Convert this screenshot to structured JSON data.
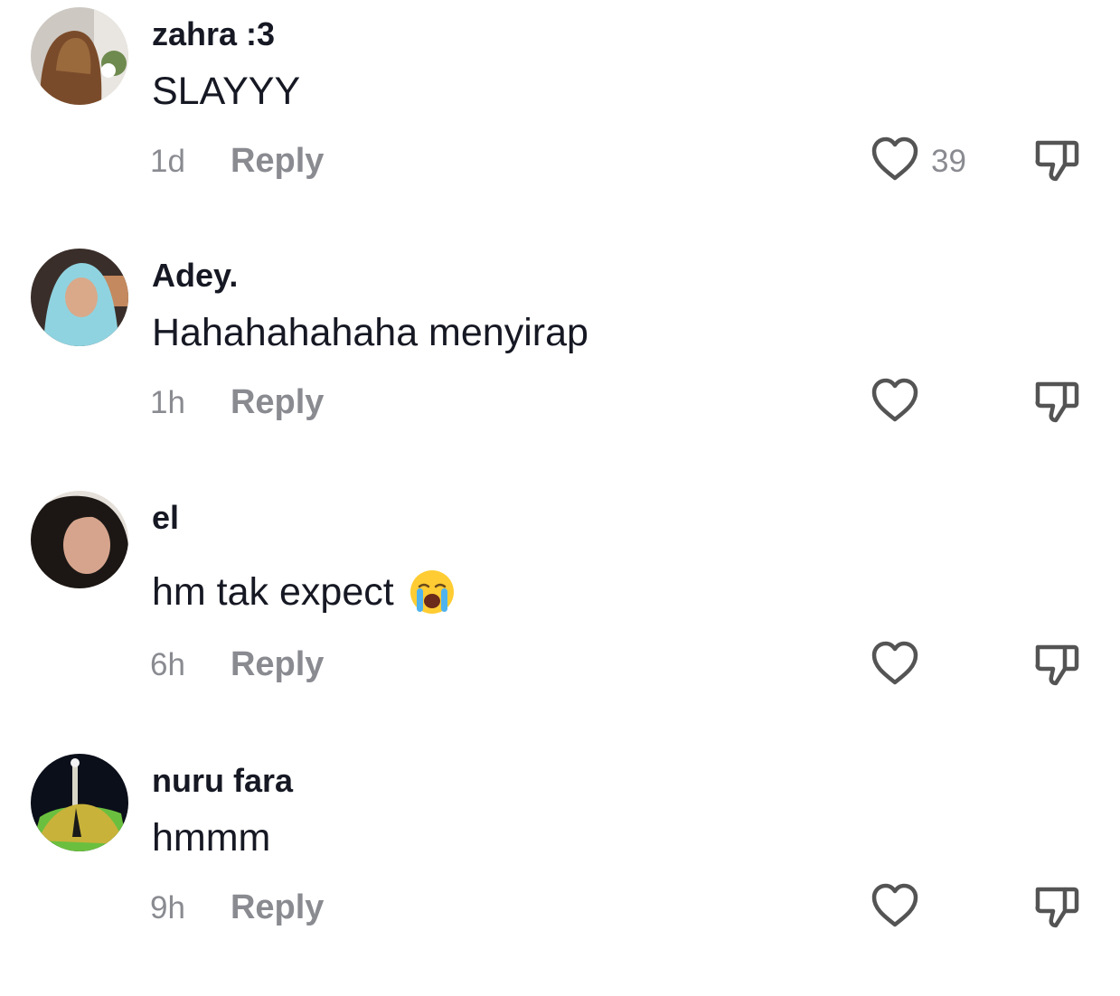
{
  "comments": [
    {
      "username": "zahra :3",
      "text": "SLAYYY",
      "time": "1d",
      "reply_label": "Reply",
      "likes": "39",
      "avatar_colors": [
        "#c7c2bd",
        "#7a4b2a",
        "#9a6a3d"
      ]
    },
    {
      "username": "Adey.",
      "text": "Hahahahahaha menyirap",
      "time": "1h",
      "reply_label": "Reply",
      "likes": "",
      "avatar_colors": [
        "#3a2e2a",
        "#8fd3e0",
        "#d9a98a"
      ]
    },
    {
      "username": "el",
      "text": "hm tak expect",
      "emoji": "loudly-crying-face",
      "time": "6h",
      "reply_label": "Reply",
      "likes": "",
      "avatar_colors": [
        "#e6e0da",
        "#1c1714",
        "#d6a48d"
      ]
    },
    {
      "username": "nuru fara",
      "text": "hmmm",
      "time": "9h",
      "reply_label": "Reply",
      "likes": "",
      "avatar_colors": [
        "#0b0f1a",
        "#c8b23a",
        "#6bbf3f"
      ]
    }
  ],
  "icons": {
    "like": "heart-outline-icon",
    "dislike": "thumbs-down-outline-icon"
  },
  "colors": {
    "text": "#161823",
    "muted": "#8a8b91",
    "icon": "#545454"
  }
}
